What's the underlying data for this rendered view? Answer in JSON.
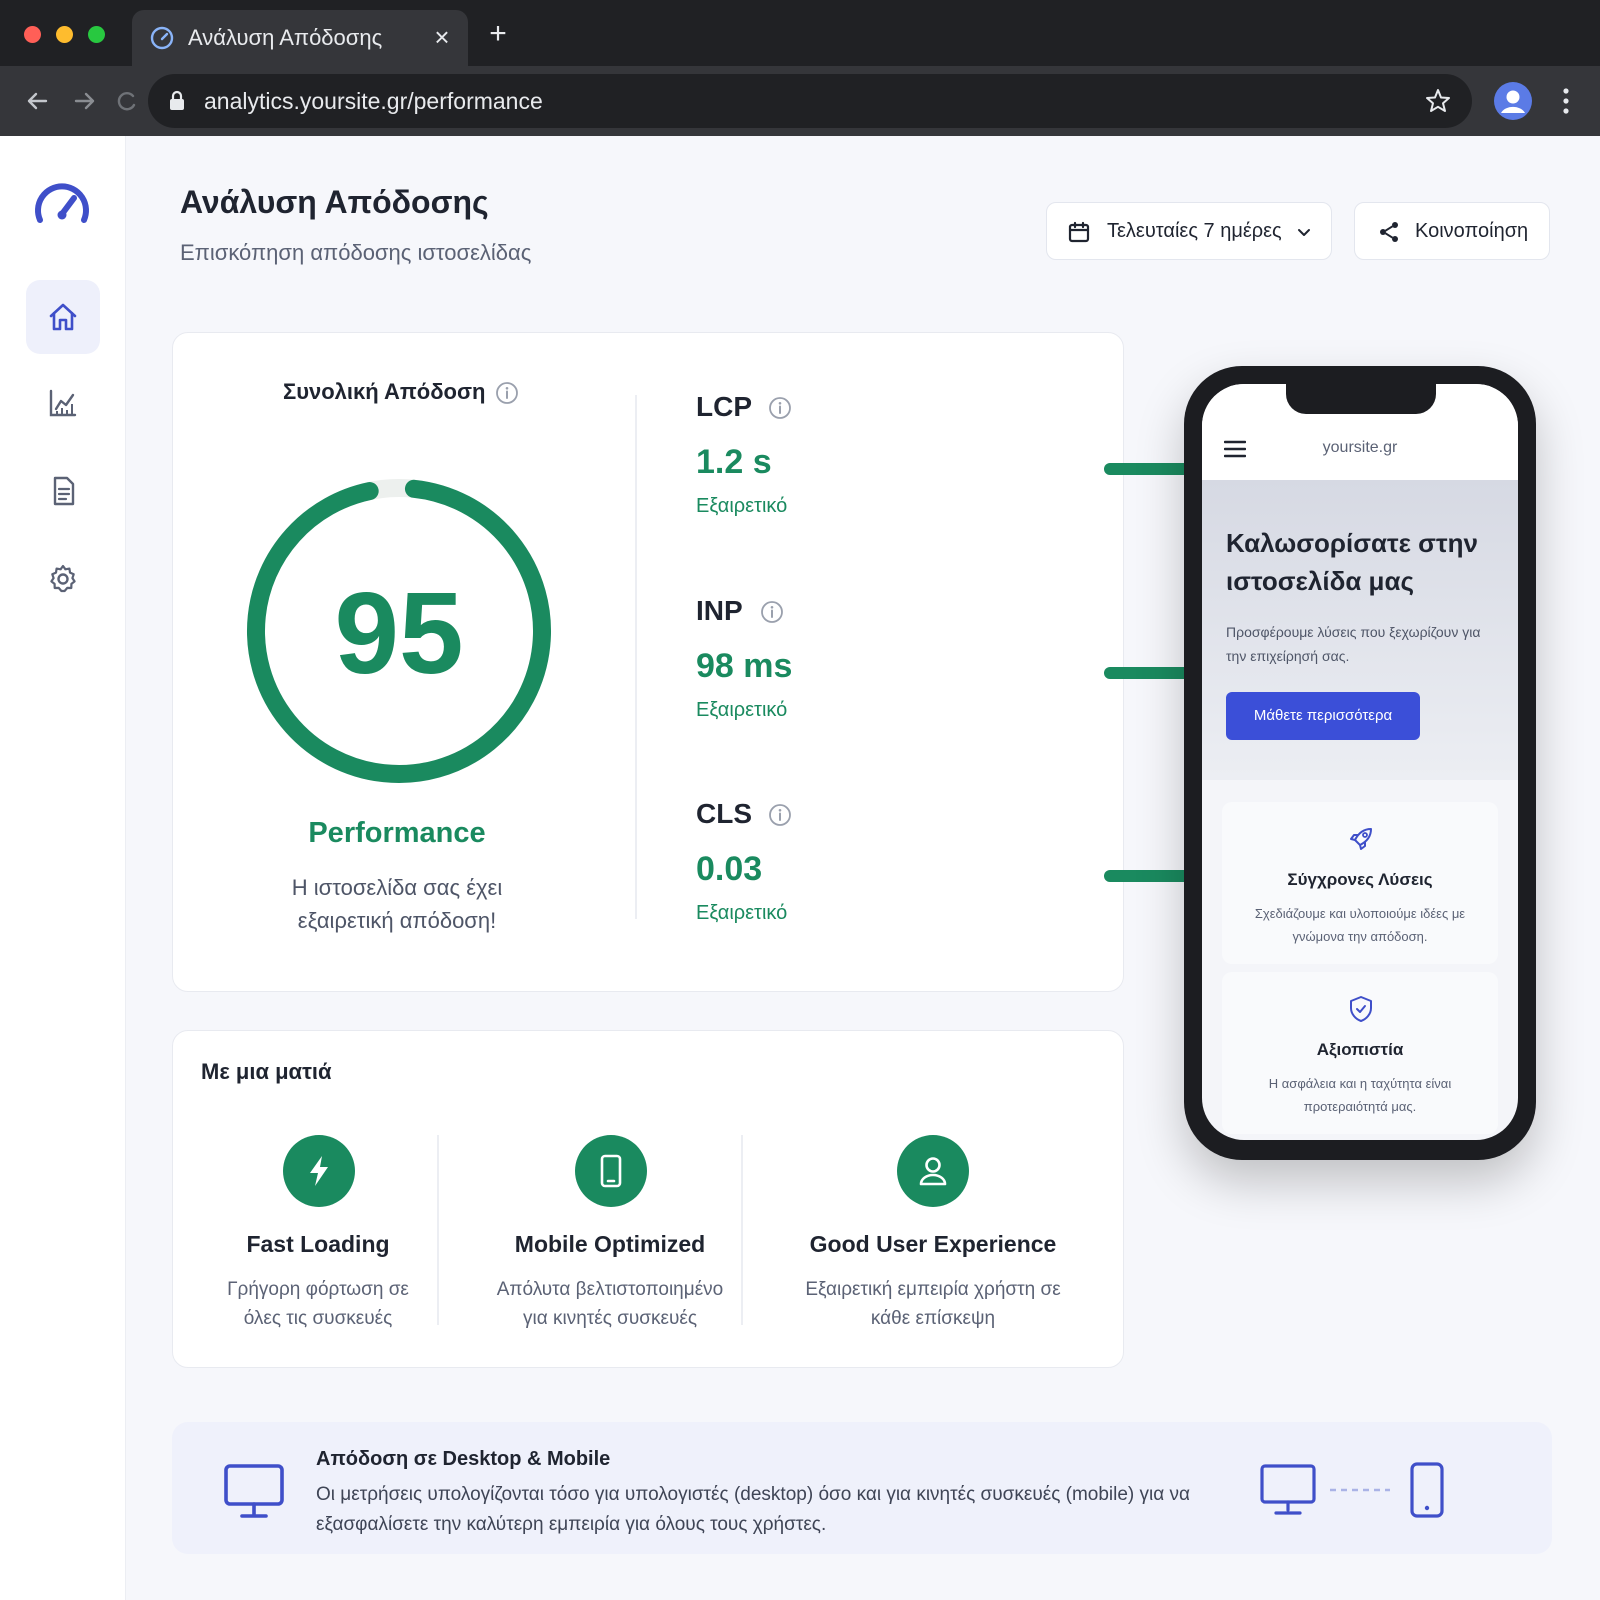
{
  "browser": {
    "tab_title": "Ανάλυση Απόδοσης",
    "url": "analytics.yoursite.gr/performance",
    "icons": [
      "tab-favicon-gauge-icon",
      "close-icon",
      "plus-icon",
      "back-icon",
      "forward-icon",
      "reload-icon",
      "lock-icon",
      "star-icon",
      "profile-icon",
      "more-vertical-icon"
    ]
  },
  "sidebar": {
    "items": [
      {
        "name": "home",
        "icon": "home-icon",
        "active": true
      },
      {
        "name": "analytics",
        "icon": "chart-icon",
        "active": false
      },
      {
        "name": "reports",
        "icon": "document-icon",
        "active": false
      },
      {
        "name": "settings",
        "icon": "gear-icon",
        "active": false
      }
    ]
  },
  "header": {
    "title": "Ανάλυση Απόδοσης",
    "subtitle": "Επισκόπηση απόδοσης ιστοσελίδας",
    "date_range": "Τελευταίες 7 ημέρες",
    "share": "Κοινοποίηση"
  },
  "overall": {
    "title": "Συνολική Απόδοση",
    "score": "95",
    "score_fraction": 0.95,
    "label": "Performance",
    "description": "Η ιστοσελίδα σας έχει εξαιρετική απόδοση!"
  },
  "metrics": [
    {
      "name": "LCP",
      "value": "1.2 s",
      "status": "Εξαιρετικό",
      "level": 0.72
    },
    {
      "name": "INP",
      "value": "98 ms",
      "status": "Εξαιρετικό",
      "level": 0.72
    },
    {
      "name": "CLS",
      "value": "0.03",
      "status": "Εξαιρετικό",
      "level": 0.72
    }
  ],
  "glance": {
    "title": "Με μια ματιά",
    "features": [
      {
        "icon": "lightning-icon",
        "title": "Fast Loading",
        "desc": "Γρήγορη φόρτωση σε όλες τις συσκευές"
      },
      {
        "icon": "smartphone-icon",
        "title": "Mobile Optimized",
        "desc": "Απόλυτα βελτιστοποιημένο για κινητές συσκευές"
      },
      {
        "icon": "user-icon",
        "title": "Good User Experience",
        "desc": "Εξαιρετική εμπειρία χρήστη σε κάθε επίσκεψη"
      }
    ]
  },
  "phone_preview": {
    "domain": "yoursite.gr",
    "hero_title": "Καλωσορίσατε στην ιστοσελίδα μας",
    "hero_text": "Προσφέρουμε λύσεις που ξεχωρίζουν για την επιχείρησή σας.",
    "hero_button": "Μάθετε περισσότερα",
    "features": [
      {
        "icon": "rocket-icon",
        "title": "Σύγχρονες Λύσεις",
        "text": "Σχεδιάζουμε και υλοποιούμε ιδέες με γνώμονα την απόδοση."
      },
      {
        "icon": "shield-check-icon",
        "title": "Αξιοπιστία",
        "text": "Η ασφάλεια και η ταχύτητα είναι προτεραιότητά μας."
      }
    ]
  },
  "banner": {
    "title": "Απόδοση σε Desktop & Mobile",
    "text": "Οι μετρήσεις υπολογίζονται τόσο για υπολογιστές (desktop) όσο και για κινητές συσκευές (mobile) για να εξασφαλίσετε την καλύτερη εμπειρία για όλους τους χρήστες."
  },
  "colors": {
    "accent_green": "#1a8a5f",
    "brand_blue": "#3b4fd8",
    "icon_indigo": "#3f4fc9",
    "chrome_dark": "#202124"
  }
}
